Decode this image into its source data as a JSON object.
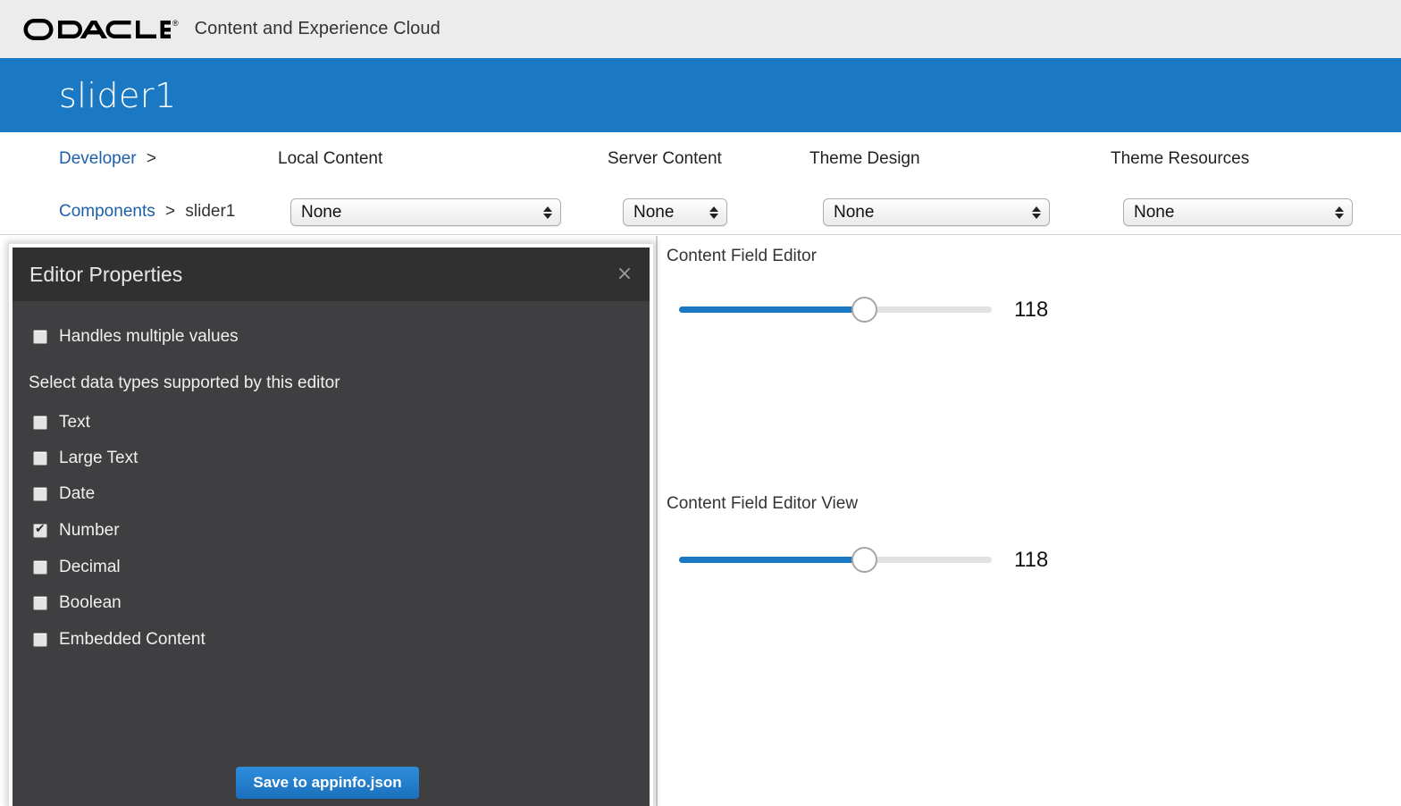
{
  "branding": {
    "logo_text": "ORACLE",
    "registered_mark": "®",
    "product_title": "Content and Experience Cloud"
  },
  "banner": {
    "app_name": "slider1"
  },
  "nav": {
    "breadcrumb": {
      "developer_link": "Developer",
      "developer_caret": ">",
      "components_link": "Components",
      "separator": ">",
      "current": "slider1"
    },
    "selectors": [
      {
        "label": "Local Content",
        "value": "None"
      },
      {
        "label": "Server Content",
        "value": "None"
      },
      {
        "label": "Theme Design",
        "value": "None"
      },
      {
        "label": "Theme Resources",
        "value": "None"
      }
    ]
  },
  "editor_properties": {
    "title": "Editor Properties",
    "close_label": "×",
    "handles_multiple": {
      "label": "Handles multiple values",
      "checked": false
    },
    "section_label": "Select data types supported by this editor",
    "data_types": [
      {
        "label": "Text",
        "checked": false
      },
      {
        "label": "Large Text",
        "checked": false
      },
      {
        "label": "Date",
        "checked": false
      },
      {
        "label": "Number",
        "checked": true
      },
      {
        "label": "Decimal",
        "checked": false
      },
      {
        "label": "Boolean",
        "checked": false
      },
      {
        "label": "Embedded Content",
        "checked": false
      }
    ],
    "save_button": "Save to appinfo.json"
  },
  "preview": {
    "sections": [
      {
        "title": "Content Field Editor",
        "slider_value": "118",
        "fill_percent": 59
      },
      {
        "title": "Content Field Editor View",
        "slider_value": "118",
        "fill_percent": 59
      }
    ]
  },
  "colors": {
    "brand_blue": "#1b78c2",
    "top_bar_gray": "#ececec",
    "panel_header": "#303031",
    "panel_body": "#3f3f41",
    "link_blue": "#1c5fa8"
  }
}
